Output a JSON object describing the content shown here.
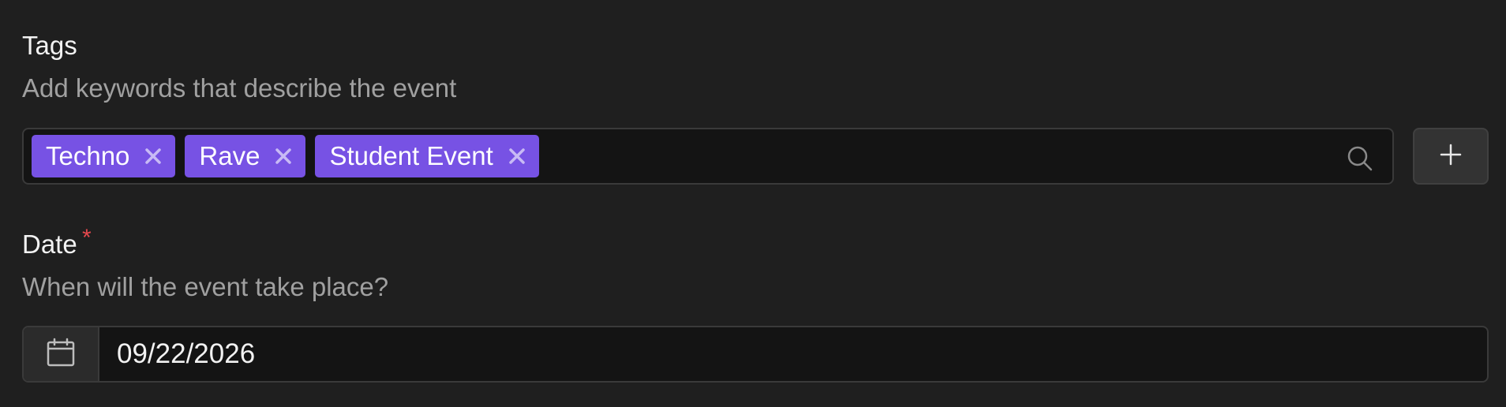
{
  "tags": {
    "label": "Tags",
    "help": "Add keywords that describe the event",
    "chips": [
      {
        "label": "Techno"
      },
      {
        "label": "Rave"
      },
      {
        "label": "Student Event"
      }
    ]
  },
  "date": {
    "label": "Date",
    "required_mark": "*",
    "help": "When will the event take place?",
    "value": "09/22/2026"
  },
  "icons": {
    "chip_remove": "close-icon",
    "search": "search-icon",
    "add": "plus-icon",
    "calendar": "calendar-icon"
  },
  "colors": {
    "background": "#1f1f1f",
    "chip": "#7752e4",
    "required": "#e5484d"
  }
}
